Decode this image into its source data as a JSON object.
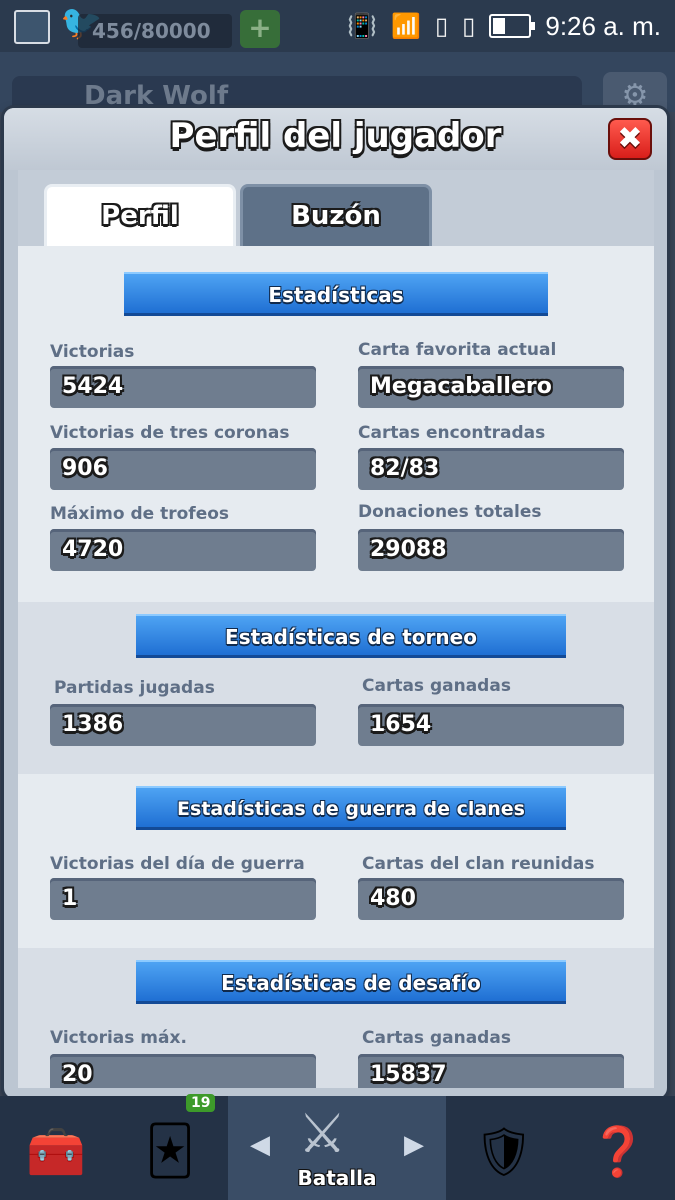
{
  "status_bar": {
    "time": "9:26 a. m.",
    "gems_display": "456/80000",
    "icons": [
      "image-icon",
      "twitter-icon",
      "vibrate-icon",
      "wifi-icon",
      "sim1-icon",
      "sim2-icon",
      "battery-icon"
    ]
  },
  "background": {
    "player_name": "Dark Wolf"
  },
  "modal": {
    "title": "Perfil del jugador",
    "close_label": "✖"
  },
  "tabs": [
    {
      "label": "Perfil",
      "active": true
    },
    {
      "label": "Buzón",
      "active": false
    }
  ],
  "sections": [
    {
      "title": "Estadísticas",
      "stats": [
        {
          "label": "Victorias",
          "value": "5424"
        },
        {
          "label": "Carta favorita actual",
          "value": "Megacaballero"
        },
        {
          "label": "Victorias de tres coronas",
          "value": "906"
        },
        {
          "label": "Cartas encontradas",
          "value": "82/83"
        },
        {
          "label": "Máximo de trofeos",
          "value": "4720"
        },
        {
          "label": "Donaciones totales",
          "value": "29088"
        }
      ]
    },
    {
      "title": "Estadísticas de torneo",
      "stats": [
        {
          "label": "Partidas jugadas",
          "value": "1386"
        },
        {
          "label": "Cartas ganadas",
          "value": "1654"
        }
      ]
    },
    {
      "title": "Estadísticas de guerra de clanes",
      "stats": [
        {
          "label": "Victorias del día de guerra",
          "value": "1"
        },
        {
          "label": "Cartas del clan reunidas",
          "value": "480"
        }
      ]
    },
    {
      "title": "Estadísticas de desafío",
      "stats": [
        {
          "label": "Victorias máx.",
          "value": "20"
        },
        {
          "label": "Cartas ganadas",
          "value": "15837"
        }
      ]
    }
  ],
  "bottom_nav": {
    "items": [
      {
        "name": "shop-chest-icon"
      },
      {
        "name": "cards-icon",
        "badge": "19"
      },
      {
        "name": "battle-swords-icon",
        "label": "Batalla",
        "active": true
      },
      {
        "name": "clan-icon"
      },
      {
        "name": "tournament-question-icon"
      }
    ]
  },
  "colors": {
    "ribbon_blue": "#2f86e6",
    "close_red": "#e32b23",
    "stat_box": "#6f7d8f",
    "label_gray": "#5f6f86"
  }
}
